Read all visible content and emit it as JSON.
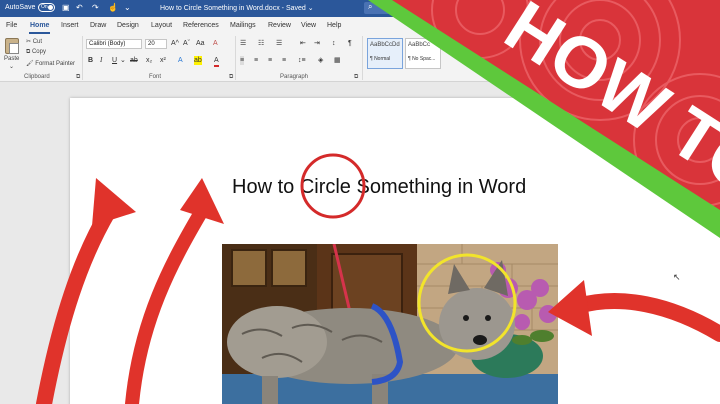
{
  "titlebar": {
    "autosave_label": "AutoSave",
    "autosave_state": "On",
    "document_title": "How to Circle Something in Word.docx",
    "saved_status": "Saved",
    "search_placeholder": "Search (A",
    "quick_access": [
      "save-icon",
      "undo-icon",
      "redo-icon",
      "touch-mode-icon"
    ]
  },
  "tabs": [
    "File",
    "Home",
    "Insert",
    "Draw",
    "Design",
    "Layout",
    "References",
    "Mailings",
    "Review",
    "View",
    "Help"
  ],
  "active_tab": "Home",
  "clipboard": {
    "paste": "Paste",
    "cut": "Cut",
    "copy": "Copy",
    "format_painter": "Format Painter",
    "group_label": "Clipboard"
  },
  "font": {
    "family": "Calibri (Body)",
    "size": "20",
    "group_label": "Font",
    "bold": "B",
    "italic": "I",
    "underline": "U",
    "grow": "A",
    "shrink": "A",
    "case": "Aa",
    "clear": "A",
    "strike": "ab",
    "subscript": "x₂",
    "superscript": "x²",
    "text_effects": "A",
    "highlight": "ab",
    "font_color": "A"
  },
  "paragraph": {
    "group_label": "Paragraph",
    "show_marks": "¶",
    "sort": "↕"
  },
  "styles": [
    {
      "preview": "AaBbCcDd",
      "name": "¶ Normal"
    },
    {
      "preview": "AaBbCc",
      "name": "¶ No Spac..."
    }
  ],
  "document": {
    "heading_before": "How to ",
    "heading_circled": "Circle",
    "heading_after": " Something in Word"
  },
  "thumbnail": {
    "label": "HOW TO",
    "banner_color": "#d9343a",
    "stripe_color": "#5ec83c"
  },
  "colors": {
    "word_blue": "#2b579a",
    "red_circle": "#d42a2a",
    "yellow_circle": "#f2e42b",
    "arrow_red": "#e0332b"
  }
}
